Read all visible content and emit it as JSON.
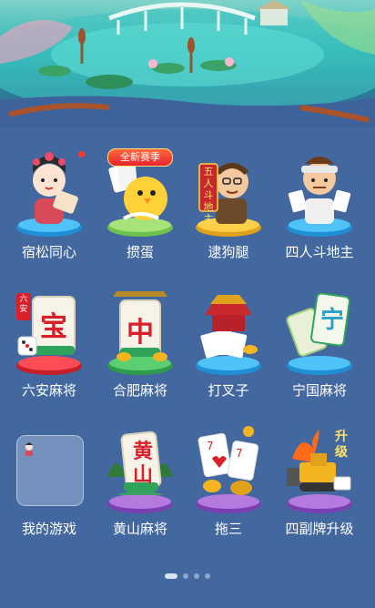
{
  "colors": {
    "background": "#43679f",
    "label": "#ffffff",
    "badge_red": "#ff3b30"
  },
  "banner": {
    "icon": "lotus-pond-scenery"
  },
  "apps": [
    {
      "label": "宿松同心",
      "icon": "opera-character-icon",
      "notification": true
    },
    {
      "label": "掼蛋",
      "icon": "yellow-chick-cards-icon",
      "badge": "全新赛季"
    },
    {
      "label": "逮狗腿",
      "icon": "man-with-cards-icon",
      "sign": "五人斗地主"
    },
    {
      "label": "四人斗地主",
      "icon": "player-with-cards-icon"
    },
    {
      "label": "六安麻将",
      "icon": "mahjong-tile-icon",
      "tile_text": "宝",
      "sign": "六安"
    },
    {
      "label": "合肥麻将",
      "icon": "mahjong-tile-icon",
      "tile_text": "中"
    },
    {
      "label": "打叉子",
      "icon": "pagoda-cards-icon"
    },
    {
      "label": "宁国麻将",
      "icon": "mahjong-tile-icon",
      "tile_text": "宁"
    },
    {
      "label": "我的游戏",
      "icon": "folder-icon"
    },
    {
      "label": "黄山麻将",
      "icon": "mahjong-tile-icon",
      "tile_text": "黄山"
    },
    {
      "label": "拖三",
      "icon": "playing-cards-icon"
    },
    {
      "label": "四副牌升级",
      "icon": "bulldozer-icon",
      "sign": "升级"
    }
  ],
  "pagination": {
    "pages": 4,
    "current": 1
  }
}
